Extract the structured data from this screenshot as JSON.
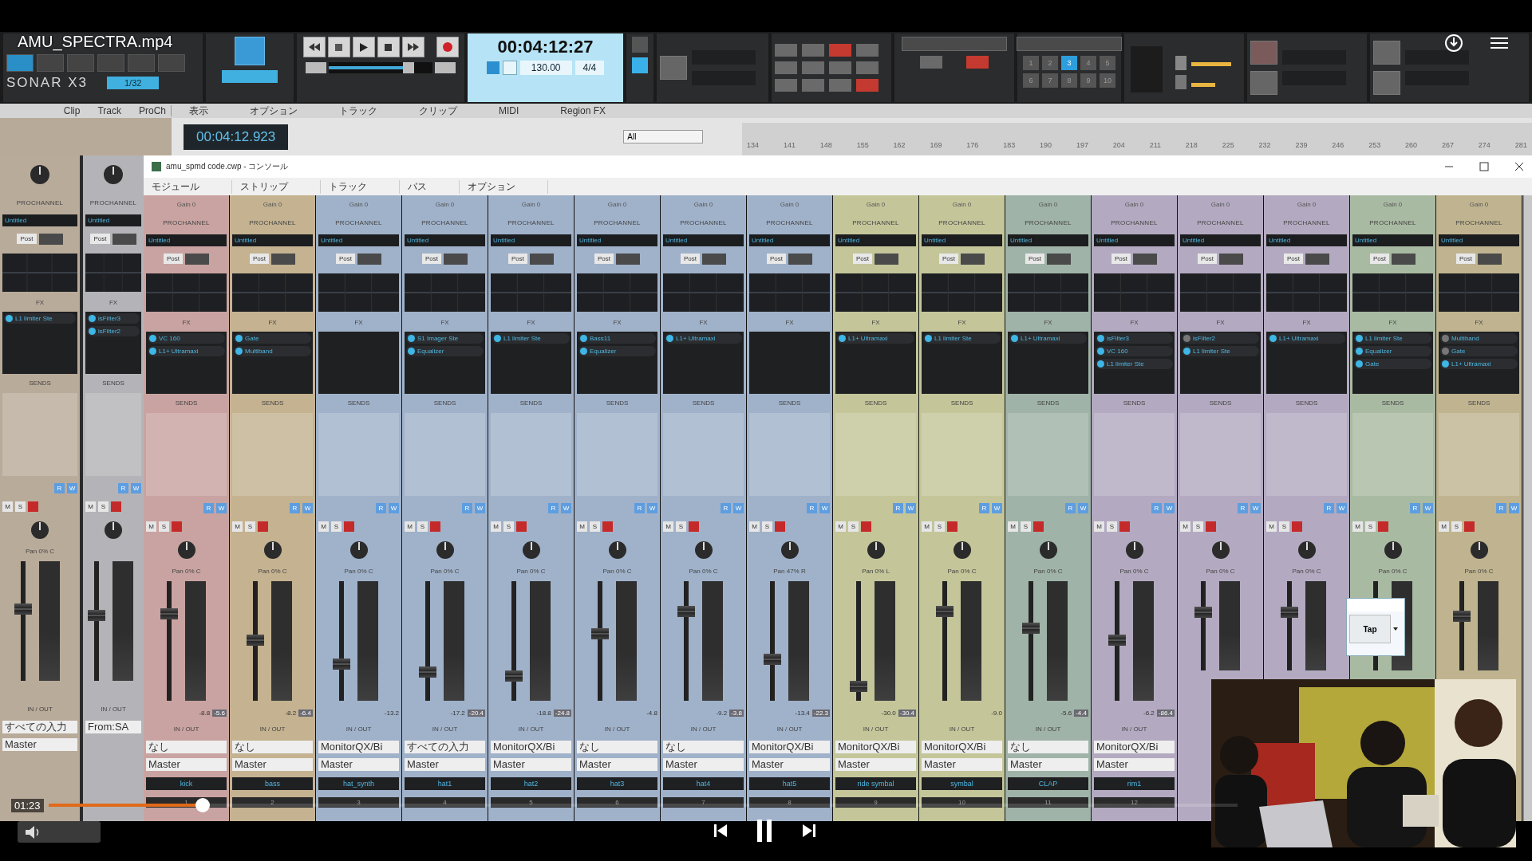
{
  "video": {
    "title": "AMU_SPECTRA.mp4",
    "time": "01:23",
    "progress": {
      "level": 0.13
    }
  },
  "toolbar": {
    "logo": "SONAR X3",
    "snap": "1/32",
    "position": {
      "level": 0.77
    },
    "counter": "00:04:12:27",
    "tempo": "130.00",
    "meter": "4/4",
    "screensets": [
      {
        "label": "1",
        "selected": false
      },
      {
        "label": "2",
        "selected": false
      },
      {
        "label": "3",
        "selected": true
      },
      {
        "label": "4",
        "selected": false
      },
      {
        "label": "5",
        "selected": false
      },
      {
        "label": "6",
        "selected": false
      },
      {
        "label": "7",
        "selected": false
      },
      {
        "label": "8",
        "selected": false
      },
      {
        "label": "9",
        "selected": false
      },
      {
        "label": "10",
        "selected": false
      }
    ]
  },
  "track_view": {
    "tabs": [
      "Clip",
      "Track",
      "ProCh"
    ],
    "menus": [
      "表示",
      "オプション",
      "トラック",
      "クリップ",
      "MIDI",
      "Region FX"
    ],
    "now_time": "00:04:12.923",
    "filter": "All",
    "ruler": [
      "134",
      "141",
      "148",
      "155",
      "162",
      "169",
      "176",
      "183",
      "190",
      "197",
      "204",
      "211",
      "218",
      "225",
      "232",
      "239",
      "246",
      "253",
      "260",
      "267",
      "274",
      "281"
    ]
  },
  "console": {
    "title": "amu_spmd code.cwp - コンソール",
    "menus": [
      "モジュール",
      "ストリップ",
      "トラック",
      "バス",
      "オプション"
    ],
    "left_strips": [
      {
        "color": "#b9ab9a",
        "header": "PROCHANNEL",
        "preset": "Untitled",
        "post": "Post",
        "fx_title": "FX",
        "fx": [
          {
            "name": "L1 limiter Ste",
            "on": true
          }
        ],
        "sends_title": "SENDS",
        "read": "R",
        "write": "W",
        "mute": "M",
        "solo": "S",
        "pan": "Pan 0% C",
        "level": 0.6,
        "io_title": "IN / OUT",
        "input": "すべての入力",
        "output": "Master"
      },
      {
        "color": "#b4b4b8",
        "header": "PROCHANNEL",
        "preset": "Untitled",
        "post": "Post",
        "fx_title": "FX",
        "fx": [
          {
            "name": "isFilter3",
            "on": true
          },
          {
            "name": "isFilter2",
            "on": true
          }
        ],
        "sends_title": "SENDS",
        "read": "R",
        "write": "W",
        "mute": "M",
        "solo": "S",
        "level": 0.55,
        "io_title": "IN / OUT",
        "input": "From:SA"
      }
    ],
    "strips": [
      {
        "color": "#c9a3a1",
        "gain": "Gain 0",
        "header": "PROCHANNEL",
        "preset": "Untitled",
        "post": "Post",
        "fx_title": "FX",
        "fx": [
          {
            "name": "VC 160",
            "on": true
          },
          {
            "name": "L1+ Ultramaxi",
            "on": true
          }
        ],
        "sends_title": "SENDS",
        "read": "R",
        "write": "W",
        "mute": "M",
        "solo": "S",
        "pan": "Pan 0% C",
        "level": 0.73,
        "volume": "-8.8",
        "peak": "-5.6",
        "io_title": "IN / OUT",
        "input": "なし",
        "output": "Master",
        "name": "kick",
        "number": "1"
      },
      {
        "color": "#c4b290",
        "gain": "Gain 0",
        "header": "PROCHANNEL",
        "preset": "Untitled",
        "post": "Post",
        "fx_title": "FX",
        "fx": [
          {
            "name": "Gate",
            "on": true
          },
          {
            "name": "Multiband",
            "on": true
          }
        ],
        "sends_title": "SENDS",
        "read": "R",
        "write": "W",
        "mute": "M",
        "solo": "S",
        "pan": "Pan 0% C",
        "level": 0.51,
        "volume": "-8.2",
        "peak": "-6.4",
        "io_title": "IN / OUT",
        "input": "なし",
        "output": "Master",
        "name": "bass",
        "number": "2"
      },
      {
        "color": "#a0b2ca",
        "gain": "Gain 0",
        "header": "PROCHANNEL",
        "preset": "Untitled",
        "post": "Post",
        "fx_title": "FX",
        "sends_title": "SENDS",
        "read": "R",
        "write": "W",
        "mute": "M",
        "solo": "S",
        "pan": "Pan 0% C",
        "level": 0.31,
        "volume": "-13.2",
        "io_title": "IN / OUT",
        "input": "MonitorQX/Bi",
        "output": "Master",
        "name": "hat_synth",
        "number": "3"
      },
      {
        "color": "#a0b2ca",
        "gain": "Gain 0",
        "header": "PROCHANNEL",
        "preset": "Untitled",
        "post": "Post",
        "fx_title": "FX",
        "fx": [
          {
            "name": "S1 Imager Ste",
            "on": true
          },
          {
            "name": "Equalizer",
            "on": true
          }
        ],
        "sends_title": "SENDS",
        "read": "R",
        "write": "W",
        "mute": "M",
        "solo": "S",
        "pan": "Pan 0% C",
        "level": 0.24,
        "volume": "-17.2",
        "peak": "-20.4",
        "io_title": "IN / OUT",
        "input": "すべての入力",
        "output": "Master",
        "name": "hat1",
        "number": "4"
      },
      {
        "color": "#a0b2ca",
        "gain": "Gain 0",
        "header": "PROCHANNEL",
        "preset": "Untitled",
        "post": "Post",
        "fx_title": "FX",
        "fx": [
          {
            "name": "L1 limiter Ste",
            "on": true
          }
        ],
        "sends_title": "SENDS",
        "read": "R",
        "write": "W",
        "mute": "M",
        "solo": "S",
        "pan": "Pan 0% C",
        "level": 0.21,
        "volume": "-18.8",
        "peak": "-24.8",
        "io_title": "IN / OUT",
        "input": "MonitorQX/Bi",
        "output": "Master",
        "name": "hat2",
        "number": "5"
      },
      {
        "color": "#a0b2ca",
        "gain": "Gain 0",
        "header": "PROCHANNEL",
        "preset": "Untitled",
        "post": "Post",
        "fx_title": "FX",
        "fx": [
          {
            "name": "Bass11",
            "on": true
          },
          {
            "name": "Equalizer",
            "on": true
          }
        ],
        "sends_title": "SENDS",
        "read": "R",
        "write": "W",
        "mute": "M",
        "solo": "S",
        "pan": "Pan 0% C",
        "level": 0.56,
        "volume": "-4.8",
        "io_title": "IN / OUT",
        "input": "なし",
        "output": "Master",
        "name": "hat3",
        "number": "6"
      },
      {
        "color": "#a0b2ca",
        "gain": "Gain 0",
        "header": "PROCHANNEL",
        "preset": "Untitled",
        "post": "Post",
        "fx_title": "FX",
        "fx": [
          {
            "name": "L1+ Ultramaxi",
            "on": true
          }
        ],
        "sends_title": "SENDS",
        "read": "R",
        "write": "W",
        "mute": "M",
        "solo": "S",
        "pan": "Pan 0% C",
        "level": 0.75,
        "volume": "-9.2",
        "peak": "-3.8",
        "io_title": "IN / OUT",
        "input": "なし",
        "output": "Master",
        "name": "hat4",
        "number": "7"
      },
      {
        "color": "#a0b2ca",
        "gain": "Gain 0",
        "header": "PROCHANNEL",
        "preset": "Untitled",
        "post": "Post",
        "fx_title": "FX",
        "sends_title": "SENDS",
        "read": "R",
        "write": "W",
        "mute": "M",
        "solo": "S",
        "pan": "Pan 47% R",
        "level": 0.35,
        "volume": "-13.4",
        "peak": "-22.3",
        "io_title": "IN / OUT",
        "input": "MonitorQX/Bi",
        "output": "Master",
        "name": "hat5",
        "number": "8"
      },
      {
        "color": "#c4c69a",
        "gain": "Gain 0",
        "header": "PROCHANNEL",
        "preset": "Untitled",
        "post": "Post",
        "fx_title": "FX",
        "fx": [
          {
            "name": "L1+ Ultramaxi",
            "on": true
          }
        ],
        "sends_title": "SENDS",
        "read": "R",
        "write": "W",
        "mute": "M",
        "solo": "S",
        "pan": "Pan 0% L",
        "level": 0.12,
        "volume": "-30.0",
        "peak": "-30.4",
        "io_title": "IN / OUT",
        "input": "MonitorQX/Bi",
        "output": "Master",
        "name": "ride symbal",
        "number": "9"
      },
      {
        "color": "#c4c69a",
        "gain": "Gain 0",
        "header": "PROCHANNEL",
        "preset": "Untitled",
        "post": "Post",
        "fx_title": "FX",
        "fx": [
          {
            "name": "L1 limiter Ste",
            "on": true
          }
        ],
        "sends_title": "SENDS",
        "read": "R",
        "write": "W",
        "mute": "M",
        "solo": "S",
        "pan": "Pan 0% C",
        "level": 0.75,
        "volume": "-9.0",
        "io_title": "IN / OUT",
        "input": "MonitorQX/Bi",
        "output": "Master",
        "name": "symbal",
        "number": "10"
      },
      {
        "color": "#a0b3a8",
        "gain": "Gain 0",
        "header": "PROCHANNEL",
        "preset": "Untitled",
        "post": "Post",
        "fx_title": "FX",
        "fx": [
          {
            "name": "L1+ Ultramaxi",
            "on": true
          }
        ],
        "sends_title": "SENDS",
        "read": "R",
        "write": "W",
        "mute": "M",
        "solo": "S",
        "pan": "Pan 0% C",
        "level": 0.61,
        "volume": "-5.6",
        "peak": "-4.4",
        "io_title": "IN / OUT",
        "input": "なし",
        "output": "Master",
        "name": "CLAP",
        "number": "11"
      },
      {
        "color": "#b3aac1",
        "gain": "Gain 0",
        "header": "PROCHANNEL",
        "preset": "Untitled",
        "post": "Post",
        "fx_title": "FX",
        "fx": [
          {
            "name": "isFilter3",
            "on": true
          },
          {
            "name": "VC 160",
            "on": true
          },
          {
            "name": "L1 limiter Ste",
            "on": true
          }
        ],
        "sends_title": "SENDS",
        "read": "R",
        "write": "W",
        "mute": "M",
        "solo": "S",
        "pan": "Pan 0% C",
        "level": 0.51,
        "volume": "-6.2",
        "peak": "-86.4",
        "io_title": "IN / OUT",
        "input": "MonitorQX/Bi",
        "output": "Master",
        "name": "rim1",
        "number": "12"
      },
      {
        "color": "#b3aac1",
        "gain": "Gain 0",
        "header": "PROCHANNEL",
        "preset": "Untitled",
        "post": "Post",
        "fx_title": "FX",
        "fx": [
          {
            "name": "isFilter2",
            "on": false
          },
          {
            "name": "L1 limiter Ste",
            "on": true
          }
        ],
        "sends_title": "SENDS",
        "read": "R",
        "write": "W",
        "mute": "M",
        "solo": "S",
        "pan": "Pan 0% C",
        "level": 0.65
      },
      {
        "color": "#b3aac1",
        "gain": "Gain 0",
        "header": "PROCHANNEL",
        "preset": "Untitled",
        "post": "Post",
        "fx_title": "FX",
        "fx": [
          {
            "name": "L1+ Ultramaxi",
            "on": true
          }
        ],
        "sends_title": "SENDS",
        "read": "R",
        "write": "W",
        "mute": "M",
        "solo": "S",
        "pan": "Pan 0% C",
        "level": 0.65
      },
      {
        "color": "#a9baa2",
        "gain": "Gain 0",
        "header": "PROCHANNEL",
        "preset": "Untitled",
        "post": "Post",
        "fx_title": "FX",
        "fx": [
          {
            "name": "L1 limiter Ste",
            "on": true
          },
          {
            "name": "Equalizer",
            "on": true
          },
          {
            "name": "Gate",
            "on": true
          }
        ],
        "sends_title": "SENDS",
        "read": "R",
        "write": "W",
        "mute": "M",
        "solo": "S",
        "pan": "Pan 0% C"
      },
      {
        "color": "#c0b490",
        "gain": "Gain 0",
        "header": "PROCHANNEL",
        "preset": "Untitled",
        "post": "Post",
        "fx_title": "FX",
        "fx": [
          {
            "name": "Multiband",
            "on": false
          },
          {
            "name": "Gate",
            "on": false
          },
          {
            "name": "L1+ Ultramaxi",
            "on": true
          }
        ],
        "sends_title": "SENDS",
        "read": "R",
        "write": "W",
        "mute": "M",
        "solo": "S",
        "pan": "Pan 0% C",
        "level": 0.61
      }
    ]
  },
  "tap_popup": {
    "button": "Tap"
  }
}
